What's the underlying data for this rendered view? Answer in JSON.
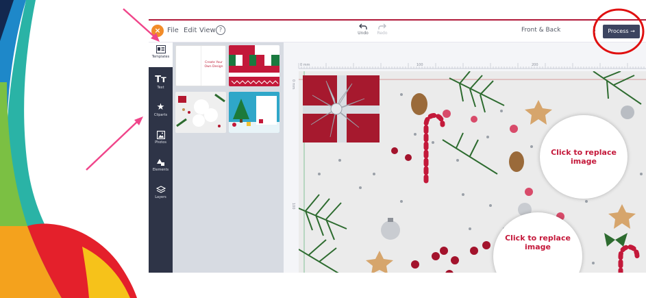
{
  "menu": {
    "logo_glyph": "×",
    "file": "File",
    "edit": "Edit",
    "view": "View",
    "help_glyph": "?"
  },
  "history": {
    "undo": "Undo",
    "redo": "Redo"
  },
  "side_toggle": "Front & Back",
  "process_button": "Process →",
  "tools": [
    {
      "label": "Templates",
      "icon": "templates-icon"
    },
    {
      "label": "Text",
      "icon": "text-icon",
      "glyph": "Tᴛ"
    },
    {
      "label": "Cliparts",
      "icon": "star-icon",
      "glyph": "★"
    },
    {
      "label": "Photos",
      "icon": "photo-icon"
    },
    {
      "label": "Elements",
      "icon": "shapes-icon"
    },
    {
      "label": "Layers",
      "icon": "layers-icon"
    }
  ],
  "templates": {
    "create_own": "Create Your Own Design"
  },
  "ruler": {
    "top_labels": [
      "0 mm",
      "100",
      "200"
    ],
    "left_labels": [
      "0 mm",
      "100"
    ]
  },
  "canvas": {
    "placeholder_1": "Click to replace image",
    "placeholder_2": "Click to replace image"
  },
  "colors": {
    "accent_red": "#c4183a",
    "sidebar": "#2e3447",
    "process_button": "#3c4460",
    "annotation_arrow": "#f0458a",
    "annotation_circle": "#e01010"
  }
}
